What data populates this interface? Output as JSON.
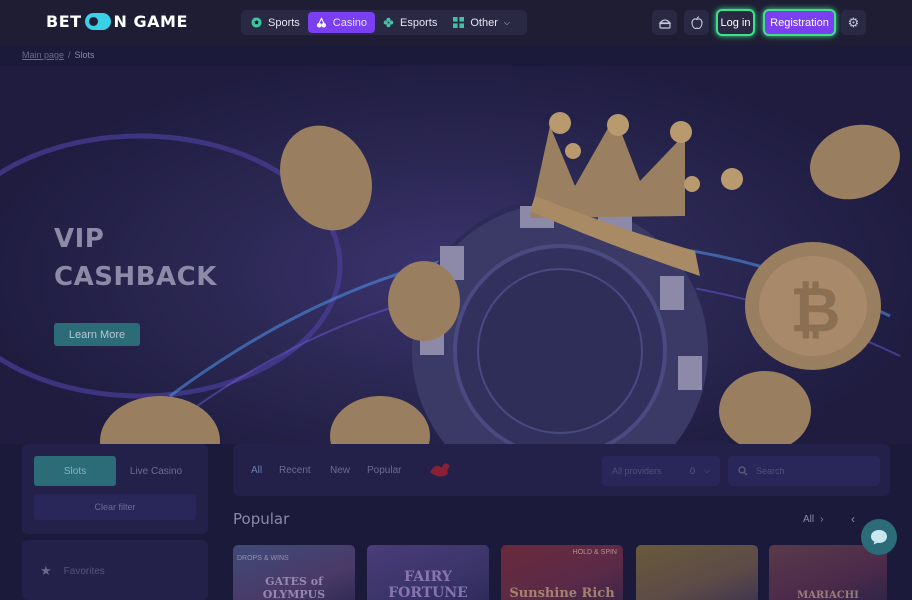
{
  "header": {
    "logo": {
      "part1": "BET",
      "part2": "N GAME"
    },
    "nav": [
      {
        "label": "Sports",
        "icon": "soccer-ball-icon",
        "active": false
      },
      {
        "label": "Casino",
        "icon": "cherries-icon",
        "active": true
      },
      {
        "label": "Esports",
        "icon": "gamepad-icon",
        "active": false
      },
      {
        "label": "Other",
        "icon": "grid-icon",
        "active": false
      }
    ],
    "login_label": "Log in",
    "register_label": "Registration",
    "colors": {
      "accent": "#7b3ff2",
      "highlight": "#3ee08a",
      "teal": "#2b6c78"
    }
  },
  "breadcrumb": {
    "home": "Main page",
    "separator": "/",
    "current": "Slots"
  },
  "hero": {
    "title_line1": "VIP",
    "title_line2": "CASHBACK",
    "button_label": "Learn More"
  },
  "sidebar": {
    "tab_slots": "Slots",
    "tab_live": "Live Casino",
    "clear_filter": "Clear filter",
    "favorites": "Favorites"
  },
  "filters": {
    "tabs": [
      "All",
      "Recent",
      "New",
      "Popular"
    ],
    "providers_placeholder": "All providers",
    "providers_count": "0",
    "search_placeholder": "Search"
  },
  "popular": {
    "title": "Popular",
    "all_label": "All",
    "games": [
      {
        "name": "GATES of OLYMPUS",
        "sub": "DROPS & WINS"
      },
      {
        "name": "FAIRY FORTUNE",
        "sub": ""
      },
      {
        "name": "Sunshine Rich",
        "sub": "HOLD & SPIN"
      },
      {
        "name": "",
        "sub": ""
      },
      {
        "name": "MARIACHI",
        "sub": ""
      }
    ]
  }
}
